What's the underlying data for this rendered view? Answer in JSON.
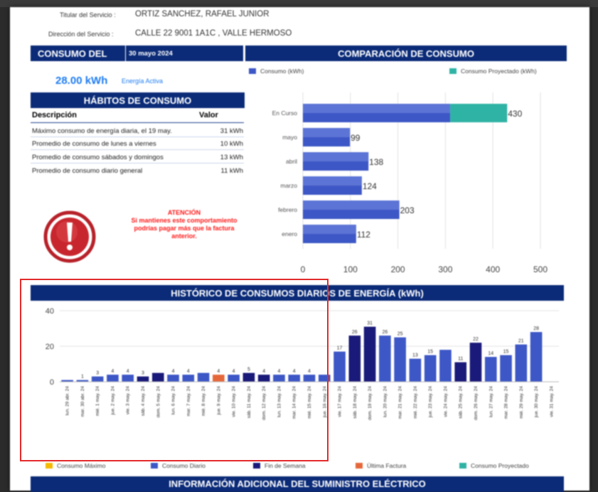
{
  "header": {
    "titular_label": "Titular del Servicio :",
    "titular_value": "ORTIZ SANCHEZ, RAFAEL JUNIOR",
    "direccion_label": "Dirección del Servicio :",
    "direccion_value": "CALLE 22   9001 1A1C , VALLE HERMOSO"
  },
  "consumo": {
    "title": "CONSUMO DEL",
    "date": "30 mayo 2024",
    "value": "28.00 kWh",
    "note": "Energía Activa"
  },
  "comparacion": {
    "title": "COMPARACIÓN DE CONSUMO",
    "legend_consumo": "Consumo (kWh)",
    "legend_proyectado": "Consumo Proyectado (kWh)"
  },
  "habitos": {
    "title": "HÁBITOS DE CONSUMO",
    "col_desc": "Descripción",
    "col_valor": "Valor",
    "rows": [
      {
        "desc": "Máximo consumo de energía diaria, el 19 may.",
        "valor": "31 kWh"
      },
      {
        "desc": "Promedio de consumo de lunes a viernes",
        "valor": "10 kWh"
      },
      {
        "desc": "Promedio de consumo sábados y domingos",
        "valor": "13 kWh"
      },
      {
        "desc": "Promedio de consumo diario general",
        "valor": "11 kWh"
      }
    ]
  },
  "warning": {
    "title": "ATENCIÓN",
    "text": "Si mantienes este comportamiento podrías pagar más que la factura anterior."
  },
  "historico": {
    "title": "HISTÓRICO DE CONSUMOS DIARIOS DE ENERGÍA (kWh)"
  },
  "footer": {
    "legend": [
      "Consumo Máximo",
      "Consumo Diario",
      "Fin de Semana",
      "Última Factura",
      "Consumo Proyectado"
    ],
    "info_title": "INFORMACIÓN ADICIONAL DEL SUMINISTRO ELÉCTRICO"
  },
  "colors": {
    "navy": "#0b2b78",
    "consumo": "#3d57c6",
    "proyectado": "#2fb3a4",
    "weekend": "#1a1a7a",
    "ultima": "#e5683a",
    "maximo": "#f5b800",
    "alert": "#ff1a1a"
  },
  "chart_data": [
    {
      "type": "bar",
      "orientation": "horizontal",
      "categories": [
        "En Curso",
        "mayo",
        "abril",
        "marzo",
        "febrero",
        "enero"
      ],
      "series": [
        {
          "name": "Consumo (kWh)",
          "values": [
            310,
            99,
            138,
            124,
            203,
            112
          ]
        },
        {
          "name": "Consumo Proyectado (kWh)",
          "values": [
            120,
            0,
            0,
            0,
            0,
            0
          ]
        }
      ],
      "data_labels": [
        "430",
        "99",
        "138",
        "124",
        "203",
        "112"
      ],
      "xlim": [
        0,
        500
      ],
      "xticks": [
        0,
        100,
        200,
        300,
        400,
        500
      ],
      "grid": true,
      "legend": "top"
    },
    {
      "type": "bar",
      "title": "HISTÓRICO DE CONSUMOS DIARIOS DE ENERGÍA (kWh)",
      "categories": [
        "lun. 29 abr. 24",
        "mar. 30 abr. 24",
        "mié. 1 may. 24",
        "jue. 2 may. 24",
        "vie. 3 may. 24",
        "sáb. 4 may. 24",
        "dom. 5 may. 24",
        "lun. 6 may. 24",
        "mar. 7 may. 24",
        "mié. 8 may. 24",
        "jue. 9 may. 24",
        "vie. 10 may. 24",
        "sáb. 11 may. 24",
        "dom. 12 may. 24",
        "lun. 13 may. 24",
        "mar. 14 may. 24",
        "mié. 15 may. 24",
        "jue. 16 may. 24",
        "vie. 17 may. 24",
        "sáb. 18 may. 24",
        "dom. 19 may. 24",
        "lun. 20 may. 24",
        "mar. 21 may. 24",
        "mié. 22 may. 24",
        "jue. 23 may. 24",
        "vie. 24 may. 24",
        "sáb. 25 may. 24",
        "dom. 26 may. 24",
        "lun. 27 may. 24",
        "mar. 28 may. 24",
        "mié. 29 may. 24",
        "jue. 30 may. 24",
        "vie. 31 may. 24"
      ],
      "values": [
        1,
        1,
        3,
        4,
        4,
        3,
        5,
        4,
        4,
        5,
        4,
        4,
        5,
        4,
        4,
        4,
        4,
        4,
        17,
        26,
        31,
        26,
        25,
        13,
        15,
        18,
        11,
        22,
        14,
        15,
        21,
        28,
        0
      ],
      "labels": [
        "",
        "1",
        "3",
        "4",
        "4",
        "3",
        "",
        "4",
        "4",
        "",
        "4",
        "4",
        "5",
        "4",
        "4",
        "4",
        "4",
        "",
        "17",
        "26",
        "31",
        "26",
        "25",
        "13",
        "15",
        "",
        "11",
        "22",
        "14",
        "15",
        "21",
        "28",
        ""
      ],
      "kinds": [
        "d",
        "d",
        "d",
        "d",
        "d",
        "w",
        "w",
        "d",
        "d",
        "d",
        "u",
        "d",
        "w",
        "w",
        "d",
        "d",
        "d",
        "d",
        "d",
        "w",
        "w",
        "d",
        "d",
        "d",
        "d",
        "d",
        "w",
        "w",
        "d",
        "d",
        "d",
        "d",
        "d"
      ],
      "ylim": [
        0,
        40
      ],
      "yticks": [
        0,
        20,
        40
      ],
      "grid": true
    }
  ]
}
